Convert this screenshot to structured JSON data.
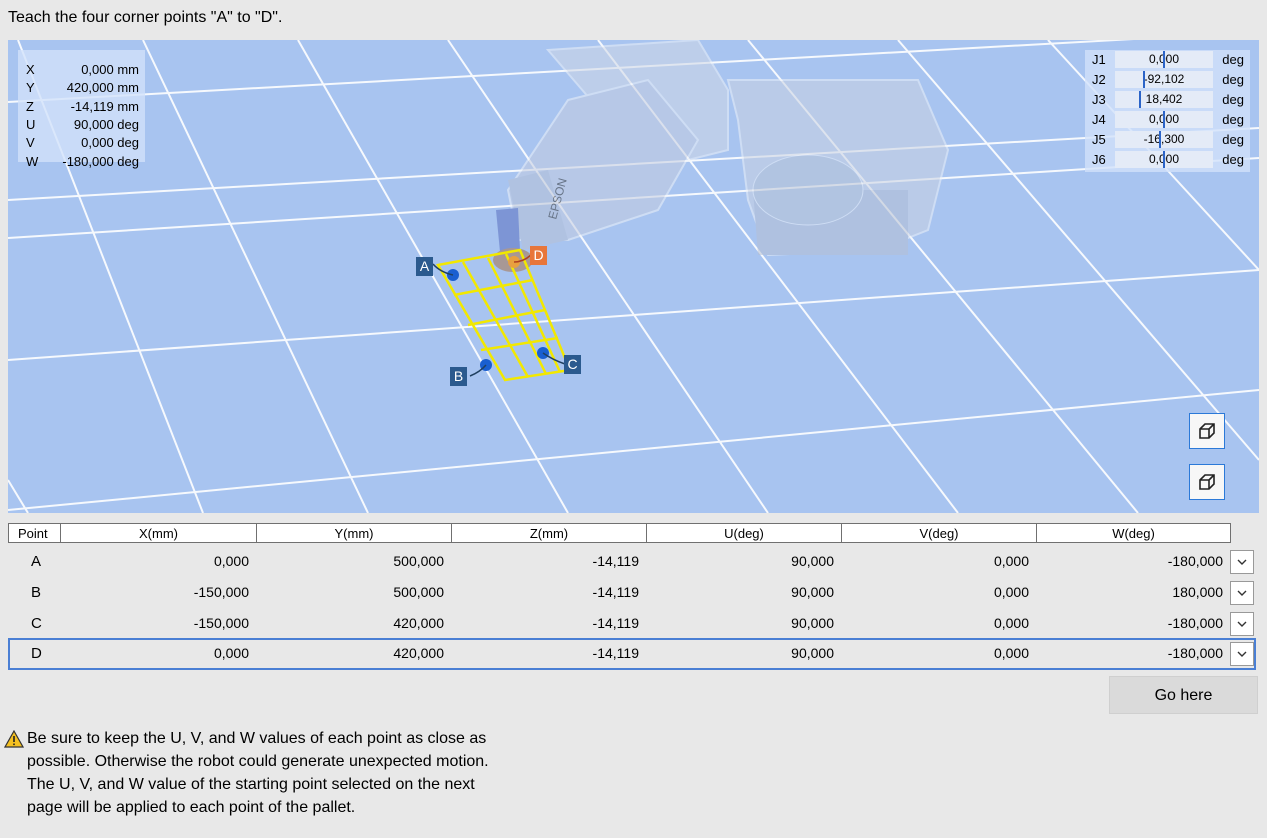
{
  "instruction": "Teach the four corner points \"A\" to \"D\".",
  "pose": [
    {
      "axis": "X",
      "value": "0,000 mm"
    },
    {
      "axis": "Y",
      "value": "420,000 mm"
    },
    {
      "axis": "Z",
      "value": "-14,119 mm"
    },
    {
      "axis": "U",
      "value": "90,000 deg"
    },
    {
      "axis": "V",
      "value": "0,000 deg"
    },
    {
      "axis": "W",
      "value": "-180,000 deg"
    }
  ],
  "joints": [
    {
      "name": "J1",
      "value": "0,000",
      "unit": "deg"
    },
    {
      "name": "J2",
      "value": "-92,102",
      "unit": "deg"
    },
    {
      "name": "J3",
      "value": "18,402",
      "unit": "deg"
    },
    {
      "name": "J4",
      "value": "0,000",
      "unit": "deg"
    },
    {
      "name": "J5",
      "value": "-16,300",
      "unit": "deg"
    },
    {
      "name": "J6",
      "value": "0,000",
      "unit": "deg"
    }
  ],
  "robot_brand": "EPSON",
  "point_labels": {
    "a": "A",
    "b": "B",
    "c": "C",
    "d": "D"
  },
  "colors": {
    "viewport_bg": "#a8c4f0",
    "grid": "#ffffff",
    "pallet": "#f2e800",
    "point": "#1a5fd0",
    "tag_blue": "#2b5a8e",
    "tag_orange": "#e8763a",
    "selected_border": "#4a7fd4"
  },
  "table": {
    "headers": [
      "Point",
      "X(mm)",
      "Y(mm)",
      "Z(mm)",
      "U(deg)",
      "V(deg)",
      "W(deg)"
    ],
    "rows": [
      {
        "point": "A",
        "x": "0,000",
        "y": "500,000",
        "z": "-14,119",
        "u": "90,000",
        "v": "0,000",
        "w": "-180,000"
      },
      {
        "point": "B",
        "x": "-150,000",
        "y": "500,000",
        "z": "-14,119",
        "u": "90,000",
        "v": "0,000",
        "w": "180,000"
      },
      {
        "point": "C",
        "x": "-150,000",
        "y": "420,000",
        "z": "-14,119",
        "u": "90,000",
        "v": "0,000",
        "w": "-180,000"
      },
      {
        "point": "D",
        "x": "0,000",
        "y": "420,000",
        "z": "-14,119",
        "u": "90,000",
        "v": "0,000",
        "w": "-180,000"
      }
    ],
    "selected_row": "D"
  },
  "go_here_label": "Go here",
  "warning": {
    "icon": "warning-triangle-icon",
    "line1": "Be sure to keep the U, V, and W values of each point as close as possible. Otherwise the robot could generate unexpected motion.",
    "line2": "The U, V, and W value of the starting point selected on the next page will be applied to each point of the pallet."
  }
}
